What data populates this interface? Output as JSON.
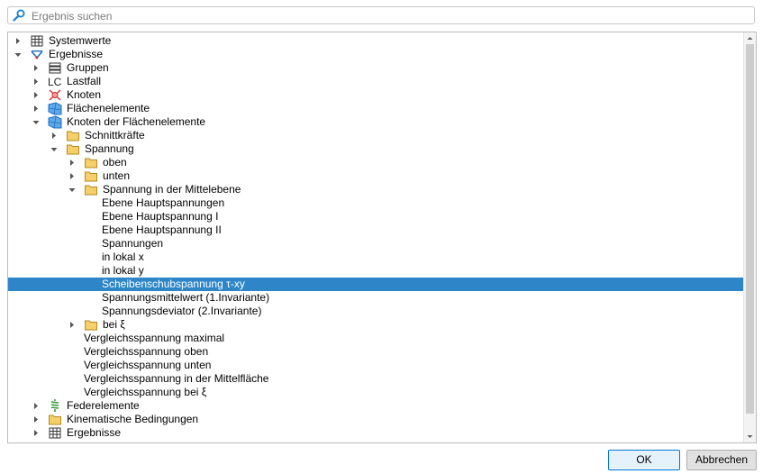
{
  "search": {
    "placeholder": "Ergebnis suchen"
  },
  "tree": {
    "items": [
      {
        "label": "Systemwerte",
        "indent": 0,
        "state": "collapsed",
        "icon": "grid-icon"
      },
      {
        "label": "Ergebnisse",
        "indent": 0,
        "state": "expanded",
        "icon": "results-icon"
      },
      {
        "label": "Gruppen",
        "indent": 1,
        "state": "collapsed",
        "icon": "groups-icon"
      },
      {
        "label": "Lastfall",
        "indent": 1,
        "state": "collapsed",
        "icon": "loadcase-icon"
      },
      {
        "label": "Knoten",
        "indent": 1,
        "state": "collapsed",
        "icon": "node-icon"
      },
      {
        "label": "Flächenelemente",
        "indent": 1,
        "state": "collapsed",
        "icon": "surface-icon"
      },
      {
        "label": "Knoten der Flächenelemente",
        "indent": 1,
        "state": "expanded",
        "icon": "surface-icon"
      },
      {
        "label": "Schnittkräfte",
        "indent": 2,
        "state": "collapsed",
        "icon": "folder-icon"
      },
      {
        "label": "Spannung",
        "indent": 2,
        "state": "expanded",
        "icon": "folder-icon"
      },
      {
        "label": "oben",
        "indent": 3,
        "state": "collapsed",
        "icon": "folder-icon"
      },
      {
        "label": "unten",
        "indent": 3,
        "state": "collapsed",
        "icon": "folder-icon"
      },
      {
        "label": "Spannung in der Mittelebene",
        "indent": 3,
        "state": "expanded",
        "icon": "folder-icon"
      },
      {
        "label": "Ebene Hauptspannungen",
        "indent": 4,
        "state": "leaf",
        "icon": ""
      },
      {
        "label": "Ebene Hauptspannung I",
        "indent": 4,
        "state": "leaf",
        "icon": ""
      },
      {
        "label": "Ebene Hauptspannung II",
        "indent": 4,
        "state": "leaf",
        "icon": ""
      },
      {
        "label": "Spannungen",
        "indent": 4,
        "state": "leaf",
        "icon": ""
      },
      {
        "label": "in lokal x",
        "indent": 4,
        "state": "leaf",
        "icon": ""
      },
      {
        "label": "in lokal y",
        "indent": 4,
        "state": "leaf",
        "icon": ""
      },
      {
        "label": "Scheibenschubspannung τ-xy",
        "indent": 4,
        "state": "leaf",
        "icon": "",
        "selected": true
      },
      {
        "label": "Spannungsmittelwert (1.Invariante)",
        "indent": 4,
        "state": "leaf",
        "icon": ""
      },
      {
        "label": "Spannungsdeviator (2.Invariante)",
        "indent": 4,
        "state": "leaf",
        "icon": ""
      },
      {
        "label": "bei ξ",
        "indent": 3,
        "state": "collapsed",
        "icon": "folder-icon"
      },
      {
        "label": "Vergleichsspannung maximal",
        "indent": 3,
        "state": "leaf",
        "icon": ""
      },
      {
        "label": "Vergleichsspannung oben",
        "indent": 3,
        "state": "leaf",
        "icon": ""
      },
      {
        "label": "Vergleichsspannung unten",
        "indent": 3,
        "state": "leaf",
        "icon": ""
      },
      {
        "label": "Vergleichsspannung in der Mittelfläche",
        "indent": 3,
        "state": "leaf",
        "icon": ""
      },
      {
        "label": "Vergleichsspannung bei ξ",
        "indent": 3,
        "state": "leaf",
        "icon": ""
      },
      {
        "label": "Federelemente",
        "indent": 1,
        "state": "collapsed",
        "icon": "spring-icon"
      },
      {
        "label": "Kinematische Bedingungen",
        "indent": 1,
        "state": "collapsed",
        "icon": "folder-icon"
      },
      {
        "label": "Ergebnisse",
        "indent": 1,
        "state": "collapsed",
        "icon": "grid-icon"
      }
    ]
  },
  "buttons": {
    "ok": "OK",
    "cancel": "Abbrechen"
  },
  "colors": {
    "selection": "#2e86c9",
    "folder": "#f5d06a",
    "accent": "#1e88e5"
  }
}
